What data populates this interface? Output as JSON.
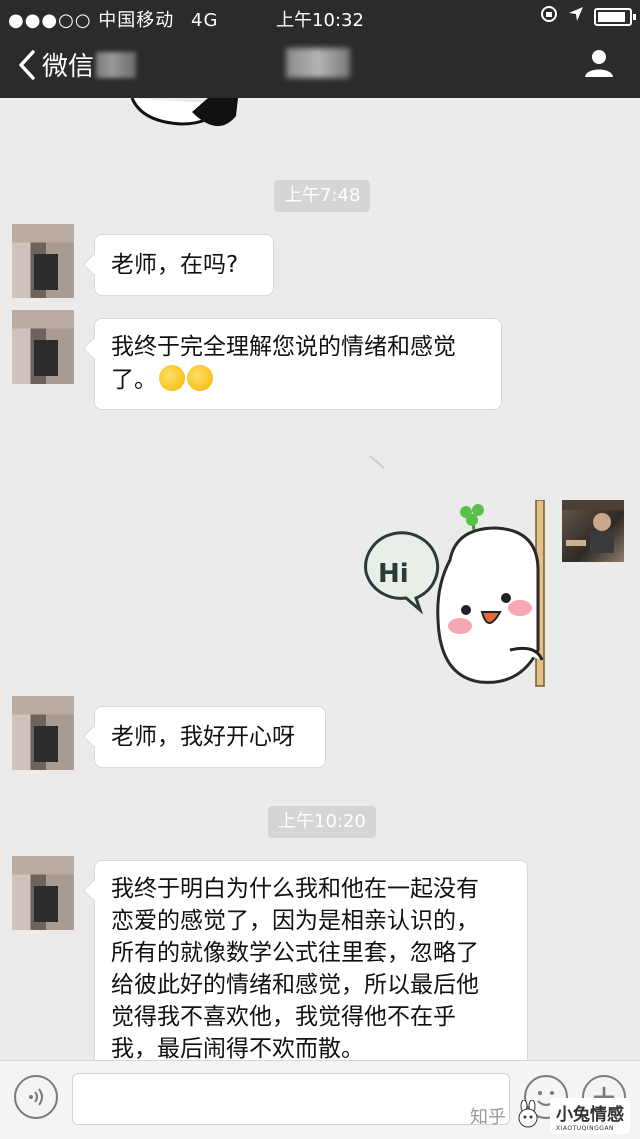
{
  "status_bar": {
    "carrier": "●●●○○ 中国移动",
    "network": "4G",
    "time": "上午10:32"
  },
  "nav": {
    "back_label": "微信"
  },
  "messages": [
    {
      "type": "time",
      "text": "上午7:48"
    },
    {
      "type": "text",
      "side": "left",
      "text": "老师，在吗?"
    },
    {
      "type": "text",
      "side": "left",
      "text": "我终于完全理解您说的情绪和感觉了。",
      "emoji_count": 2
    },
    {
      "type": "sticker",
      "side": "right",
      "text": "Hi"
    },
    {
      "type": "text",
      "side": "left",
      "text": "老师，我好开心呀"
    },
    {
      "type": "time",
      "text": "上午10:20"
    },
    {
      "type": "text",
      "side": "left",
      "lines": [
        "我终于明白为什么我和他在一起没有",
        "恋爱的感觉了，因为是相亲认识的，",
        "所有的就像数学公式往里套，忽略了",
        "给彼此好的情绪和感觉，所以最后他",
        "觉得我不喜欢他，我觉得他不在乎",
        "我，最后闹得不欢而散。"
      ]
    }
  ],
  "input_bar": {
    "plus_label": "+"
  },
  "watermark": {
    "zhihu": "知乎",
    "brand": "小兔情感",
    "brand_sub": "XIAOTUQINGGAN"
  },
  "colors": {
    "nav_bg": "#2b2b2d",
    "chat_bg": "#ebebeb",
    "bubble": "#ffffff"
  }
}
